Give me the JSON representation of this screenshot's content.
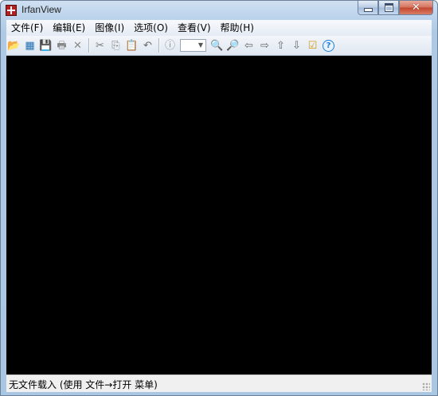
{
  "window": {
    "title": "IrfanView"
  },
  "menu": {
    "items": [
      {
        "label": "文件(F)"
      },
      {
        "label": "编辑(E)"
      },
      {
        "label": "图像(I)"
      },
      {
        "label": "选项(O)"
      },
      {
        "label": "查看(V)"
      },
      {
        "label": "帮助(H)"
      }
    ]
  },
  "toolbar": {
    "icons": [
      {
        "name": "open-folder-icon",
        "glyph": "📂",
        "color": "#d89a1c"
      },
      {
        "name": "slideshow-icon",
        "glyph": "▦",
        "color": "#1f6fb3"
      },
      {
        "name": "save-icon",
        "glyph": "💾",
        "color": "#888888"
      },
      {
        "name": "print-icon",
        "glyph": "🖶",
        "color": "#888888"
      },
      {
        "name": "delete-icon",
        "glyph": "✕",
        "color": "#888888"
      },
      {
        "name": "cut-icon",
        "glyph": "✂",
        "color": "#777777"
      },
      {
        "name": "copy-icon",
        "glyph": "⎘",
        "color": "#777777"
      },
      {
        "name": "paste-icon",
        "glyph": "📋",
        "color": "#c48a1a"
      },
      {
        "name": "undo-icon",
        "glyph": "↶",
        "color": "#6a6a6a"
      },
      {
        "name": "info-icon",
        "glyph": "ⓘ",
        "color": "#8a8a8a"
      },
      {
        "name": "zoom-in-icon",
        "glyph": "🔍",
        "color": "#777777"
      },
      {
        "name": "zoom-out-icon",
        "glyph": "🔎",
        "color": "#777777"
      },
      {
        "name": "previous-icon",
        "glyph": "⇦",
        "color": "#666666"
      },
      {
        "name": "next-icon",
        "glyph": "⇨",
        "color": "#666666"
      },
      {
        "name": "first-icon",
        "glyph": "⇧",
        "color": "#666666"
      },
      {
        "name": "last-icon",
        "glyph": "⇩",
        "color": "#666666"
      },
      {
        "name": "properties-icon",
        "glyph": "☑",
        "color": "#d49a16"
      },
      {
        "name": "help-icon",
        "glyph": "?",
        "color": "#1d7fd6"
      }
    ],
    "zoom_value": ""
  },
  "status": {
    "text": "无文件载入 (使用 文件→打开 菜单)"
  }
}
